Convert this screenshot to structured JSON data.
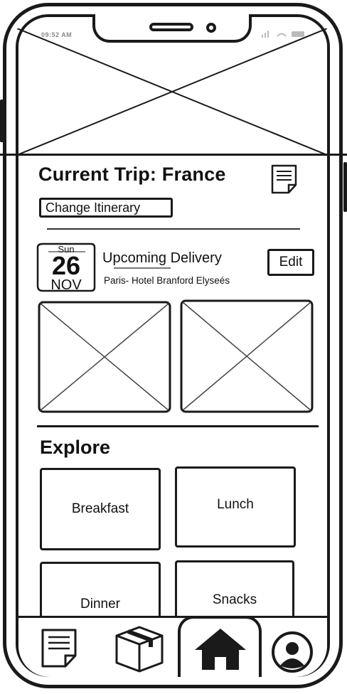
{
  "status_bar": {
    "time": "09:52 AM"
  },
  "trip": {
    "title": "Current Trip: France",
    "change_itinerary_label": "Change Itinerary"
  },
  "delivery": {
    "day_of_week": "Sun",
    "day": "26",
    "month": "NOV",
    "title": "Upcoming Delivery",
    "address": "Paris- Hotel Branford Elyseés",
    "edit_label": "Edit"
  },
  "explore": {
    "title": "Explore",
    "categories": [
      {
        "label": "Breakfast"
      },
      {
        "label": "Lunch"
      },
      {
        "label": "Dinner"
      },
      {
        "label": "Snacks"
      }
    ]
  },
  "bottom_nav": {
    "items": [
      {
        "icon": "document-icon"
      },
      {
        "icon": "package-icon"
      },
      {
        "icon": "home-icon"
      },
      {
        "icon": "profile-icon"
      }
    ]
  }
}
